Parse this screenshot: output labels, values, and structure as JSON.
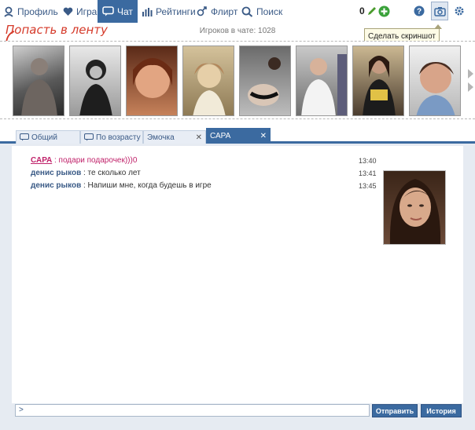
{
  "nav": {
    "items": [
      {
        "label": "Профиль",
        "icon": "profile-icon"
      },
      {
        "label": "Игра",
        "icon": "heart-icon"
      },
      {
        "label": "Чат",
        "icon": "chat-icon"
      },
      {
        "label": "Рейтинги",
        "icon": "bar-chart-icon"
      },
      {
        "label": "Флирт",
        "icon": "flirt-icon"
      },
      {
        "label": "Поиск",
        "icon": "search-icon"
      }
    ],
    "count": "0",
    "accent": "#3b6aa0"
  },
  "players_online": "Игроков в чате: 1028",
  "tooltip": "Сделать скриншот",
  "feed_cta": "Попасть в ленту",
  "tabs": [
    {
      "label": "Общий"
    },
    {
      "label": "По возрасту"
    },
    {
      "label": "Эмочка"
    },
    {
      "label": "САРА"
    }
  ],
  "messages": [
    {
      "author": "САРА",
      "text": " : подари подарочек)))0",
      "time": "13:40"
    },
    {
      "author": "денис рыков",
      "text": " : те сколько лет",
      "time": "13:41"
    },
    {
      "author": "денис рыков",
      "text": " : Напиши мне, когда будешь в игре",
      "time": "13:45"
    }
  ],
  "input": {
    "value": ">"
  },
  "buttons": {
    "send": "Отправить",
    "history": "История"
  }
}
